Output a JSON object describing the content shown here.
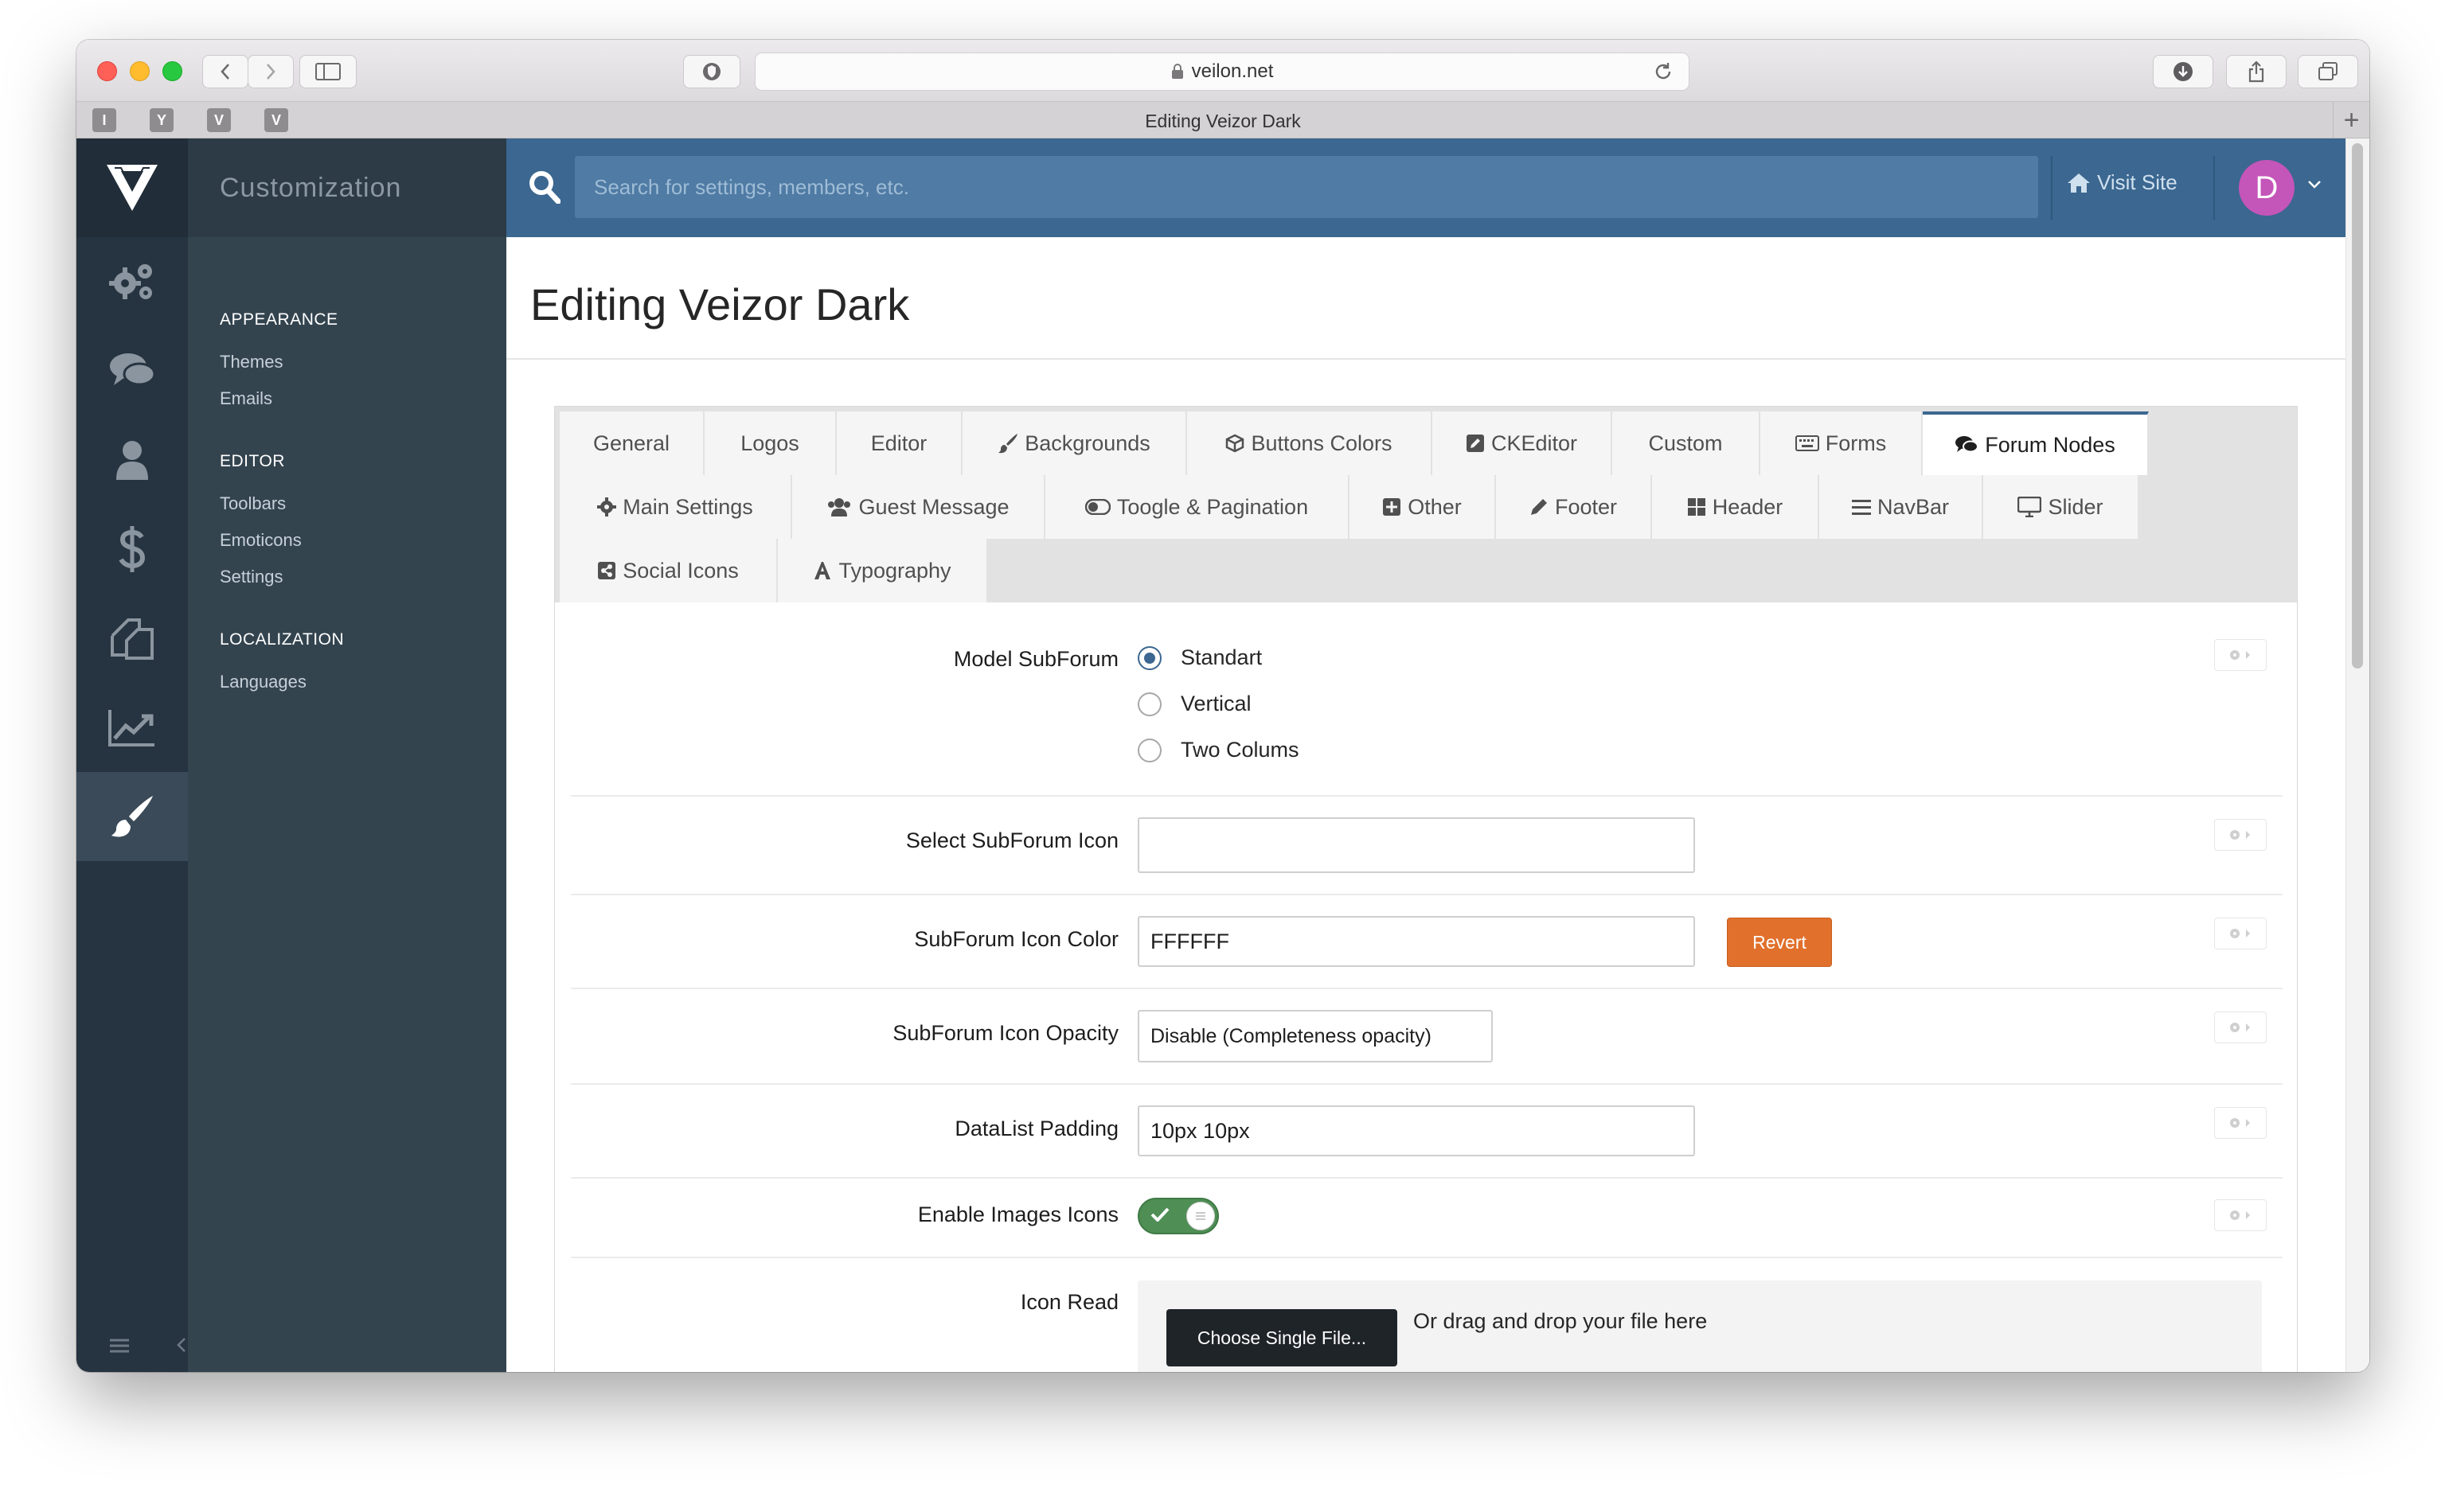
{
  "browser": {
    "url": "veilon.net",
    "tab_title": "Editing Veizor Dark",
    "favicons": [
      "I",
      "Y",
      "V",
      "V"
    ]
  },
  "sidebar": {
    "brand": "Customization",
    "sections": [
      {
        "title": "APPEARANCE",
        "items": [
          "Themes",
          "Emails"
        ]
      },
      {
        "title": "EDITOR",
        "items": [
          "Toolbars",
          "Emoticons",
          "Settings"
        ]
      },
      {
        "title": "LOCALIZATION",
        "items": [
          "Languages"
        ]
      }
    ],
    "icons": [
      "logo-icon",
      "gears-icon",
      "comments-icon",
      "user-icon",
      "dollar-icon",
      "pages-icon",
      "chart-icon",
      "brush-icon"
    ]
  },
  "topbar": {
    "search_placeholder": "Search for settings, members, etc.",
    "visit_site": "Visit Site",
    "avatar_letter": "D"
  },
  "page": {
    "title": "Editing Veizor Dark"
  },
  "tabs": [
    {
      "label": "General",
      "icon": ""
    },
    {
      "label": "Logos",
      "icon": ""
    },
    {
      "label": "Editor",
      "icon": ""
    },
    {
      "label": "Backgrounds",
      "icon": "brush-icon"
    },
    {
      "label": "Buttons Colors",
      "icon": "cube-icon"
    },
    {
      "label": "CKEditor",
      "icon": "edit-icon"
    },
    {
      "label": "Custom",
      "icon": ""
    },
    {
      "label": "Forms",
      "icon": "keyboard-icon"
    },
    {
      "label": "Forum Nodes",
      "icon": "comments-icon",
      "active": true
    },
    {
      "label": "Main Settings",
      "icon": "gear-icon"
    },
    {
      "label": "Guest Message",
      "icon": "users-icon"
    },
    {
      "label": "Toogle & Pagination",
      "icon": "toggle-icon"
    },
    {
      "label": "Other",
      "icon": "plus-square-icon"
    },
    {
      "label": "Footer",
      "icon": "pencil-icon"
    },
    {
      "label": "Header",
      "icon": "grid-icon"
    },
    {
      "label": "NavBar",
      "icon": "bars-icon"
    },
    {
      "label": "Slider",
      "icon": "desktop-icon"
    },
    {
      "label": "Social Icons",
      "icon": "share-icon"
    },
    {
      "label": "Typography",
      "icon": "font-icon"
    }
  ],
  "form": {
    "model_subforum": {
      "label": "Model SubForum",
      "options": [
        "Standart",
        "Vertical",
        "Two Colums"
      ],
      "selected": "Standart"
    },
    "subforum_icon": {
      "label": "Select SubForum Icon",
      "value": ""
    },
    "subforum_icon_color": {
      "label": "SubForum Icon Color",
      "value": "FFFFFF",
      "revert": "Revert"
    },
    "subforum_icon_opacity": {
      "label": "SubForum Icon Opacity",
      "value": "Disable (Completeness opacity)"
    },
    "datalist_padding": {
      "label": "DataList Padding",
      "value": "10px 10px"
    },
    "enable_images_icons": {
      "label": "Enable Images Icons",
      "on": true
    },
    "icon_read": {
      "label": "Icon Read",
      "button": "Choose Single File...",
      "drop_text": "Or drag and drop your file here"
    }
  },
  "colors": {
    "topbar": "#3b6790",
    "iconbar": "#263340",
    "sidenav": "#33444f",
    "revert_button": "#e0702c",
    "toggle_on": "#4f8e55",
    "avatar": "#c455b9"
  }
}
